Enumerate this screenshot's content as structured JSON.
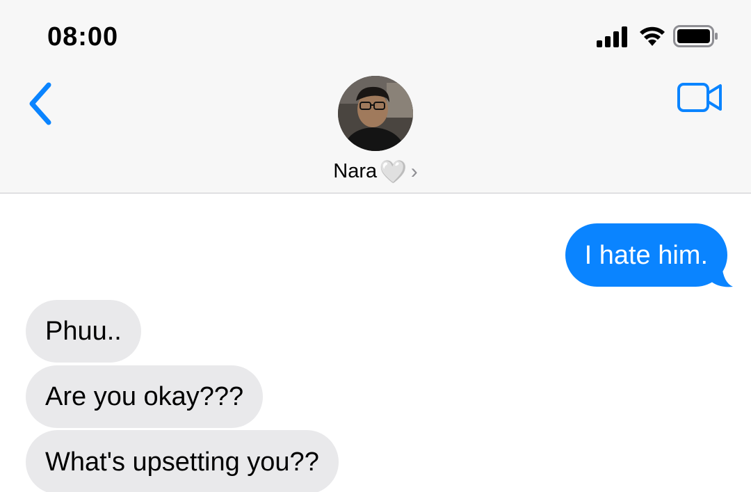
{
  "status_bar": {
    "time": "08:00",
    "signal_icon": "cellular-signal-icon",
    "wifi_icon": "wifi-icon",
    "battery_icon": "battery-icon"
  },
  "nav": {
    "back_icon": "chevron-left-icon",
    "video_icon": "video-camera-icon",
    "contact_name": "Nara",
    "contact_emoji": "🤍",
    "chevron": "›"
  },
  "colors": {
    "accent": "#0a84ff",
    "sent_bubble": "#0a84ff",
    "received_bubble": "#e9e9eb"
  },
  "messages": [
    {
      "direction": "sent",
      "text": "I hate him."
    },
    {
      "direction": "received",
      "text": "Phuu.."
    },
    {
      "direction": "received",
      "text": "Are you okay???"
    },
    {
      "direction": "received",
      "text": "What's upsetting you??"
    }
  ]
}
